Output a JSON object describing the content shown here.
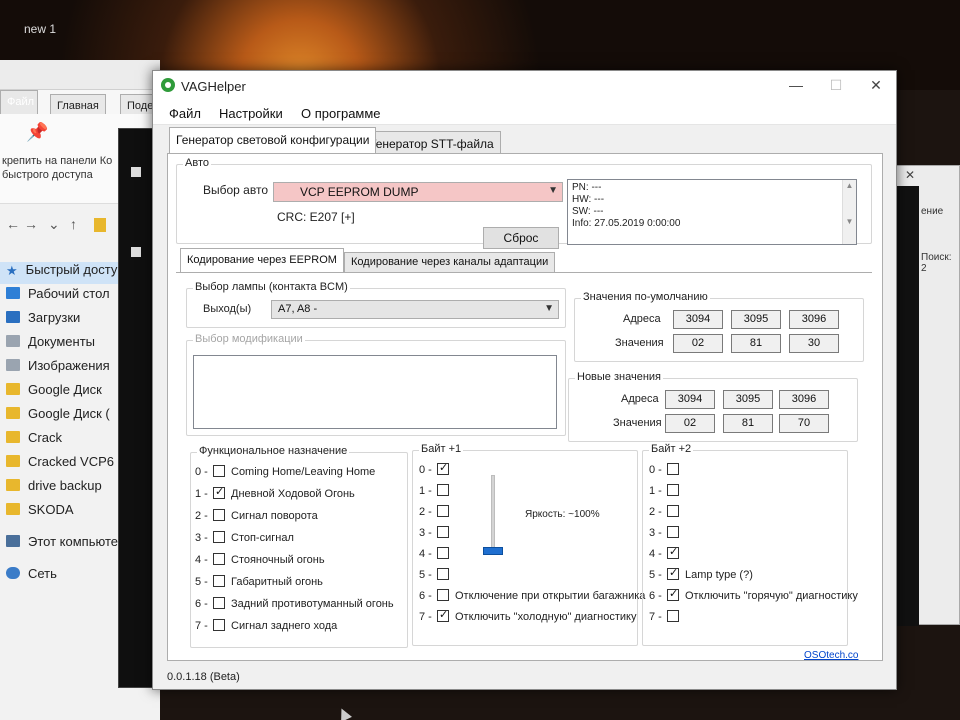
{
  "desktop": {
    "icon_label": "new 1"
  },
  "explorer": {
    "tabs": [
      "Файл",
      "Главная",
      "Поде"
    ],
    "pin_text_1": "крепить на панели Ко",
    "pin_text_2": "быстрого доступа",
    "nav_arrows": [
      "←",
      "→",
      "⌄",
      "↑"
    ],
    "nav_items": [
      {
        "label": "Быстрый досту"
      },
      {
        "label": "Рабочий стол"
      },
      {
        "label": "Загрузки"
      },
      {
        "label": "Документы"
      },
      {
        "label": "Изображения"
      },
      {
        "label": "Google Диск"
      },
      {
        "label": "Google Диск ("
      },
      {
        "label": "Crack"
      },
      {
        "label": "Cracked VCP6"
      },
      {
        "label": "drive backup"
      },
      {
        "label": "SKODA"
      },
      {
        "label": "Этот компьюте"
      },
      {
        "label": "Сеть"
      }
    ]
  },
  "right_window": {
    "text1": "ение",
    "text2": "Поиск: 2"
  },
  "window": {
    "title": "VAGHelper",
    "controls": {
      "minimize": "—",
      "maximize": "☐",
      "close": "✕"
    },
    "menu": [
      "Файл",
      "Настройки",
      "О программе"
    ],
    "main_tabs": [
      "Генератор световой конфигурации",
      "Генератор STT-файла"
    ],
    "auto": {
      "group_label": "Авто",
      "select_label": "Выбор авто",
      "select_value": "VCP EEPROM DUMP",
      "crc": "CRC: E207 [+]",
      "reset_button": "Сброс",
      "info_lines": [
        "PN: ---",
        "HW: ---",
        "SW: ---",
        "Info: 27.05.2019 0:00:00"
      ]
    },
    "sub_tabs": [
      "Кодирование через EEPROM",
      "Кодирование через каналы адаптации"
    ],
    "lamp": {
      "group_label": "Выбор лампы (контакта BCM)",
      "outputs_label": "Выходы)",
      "outputs_prefix": "Выход(ы)",
      "outputs_value": "A7, A8 -"
    },
    "modification": {
      "group_label": "Выбор модификации"
    },
    "defaults": {
      "group_label": "Значения по-умолчанию",
      "address_label": "Адреса",
      "values_label": "Значения",
      "addresses": [
        "3094",
        "3095",
        "3096"
      ],
      "values": [
        "02",
        "81",
        "30"
      ]
    },
    "new_values": {
      "group_label": "Новые значения",
      "address_label": "Адреса",
      "values_label": "Значения",
      "addresses": [
        "3094",
        "3095",
        "3096"
      ],
      "values": [
        "02",
        "81",
        "70"
      ]
    },
    "function": {
      "group_label": "Функциональное назначение",
      "rows": [
        {
          "num": "0 -",
          "label": "Coming Home/Leaving Home",
          "checked": false
        },
        {
          "num": "1 -",
          "label": "Дневной Ходовой Огонь",
          "checked": true
        },
        {
          "num": "2 -",
          "label": "Сигнал поворота",
          "checked": false
        },
        {
          "num": "3 -",
          "label": "Стоп-сигнал",
          "checked": false
        },
        {
          "num": "4 -",
          "label": "Стояночный огонь",
          "checked": false
        },
        {
          "num": "5 -",
          "label": "Габаритный огонь",
          "checked": false
        },
        {
          "num": "6 -",
          "label": "Задний противотуманный огонь",
          "checked": false
        },
        {
          "num": "7 -",
          "label": "Сигнал заднего хода",
          "checked": false
        }
      ]
    },
    "byte1": {
      "group_label": "Байт +1",
      "brightness_label": "Яркость: ~100%",
      "brightness_fraction": 1.0,
      "rows": [
        {
          "num": "0 -",
          "label": "",
          "checked": true
        },
        {
          "num": "1 -",
          "label": "",
          "checked": false
        },
        {
          "num": "2 -",
          "label": "",
          "checked": false
        },
        {
          "num": "3 -",
          "label": "",
          "checked": false
        },
        {
          "num": "4 -",
          "label": "",
          "checked": false
        },
        {
          "num": "5 -",
          "label": "",
          "checked": false
        },
        {
          "num": "6 -",
          "label": "Отключение при открытии багажника",
          "checked": false
        },
        {
          "num": "7 -",
          "label": "Отключить \"холодную\" диагностику",
          "checked": true
        }
      ]
    },
    "byte2": {
      "group_label": "Байт +2",
      "rows": [
        {
          "num": "0 -",
          "label": "",
          "checked": false
        },
        {
          "num": "1 -",
          "label": "",
          "checked": false
        },
        {
          "num": "2 -",
          "label": "",
          "checked": false
        },
        {
          "num": "3 -",
          "label": "",
          "checked": false
        },
        {
          "num": "4 -",
          "label": "",
          "checked": true
        },
        {
          "num": "5 -",
          "label": "Lamp type (?)",
          "checked": true
        },
        {
          "num": "6 -",
          "label": "Отключить \"горячую\" диагностику",
          "checked": true
        },
        {
          "num": "7 -",
          "label": "",
          "checked": false
        }
      ]
    },
    "link": "OSOtech.co",
    "version": "0.0.1.18 (Beta)"
  }
}
